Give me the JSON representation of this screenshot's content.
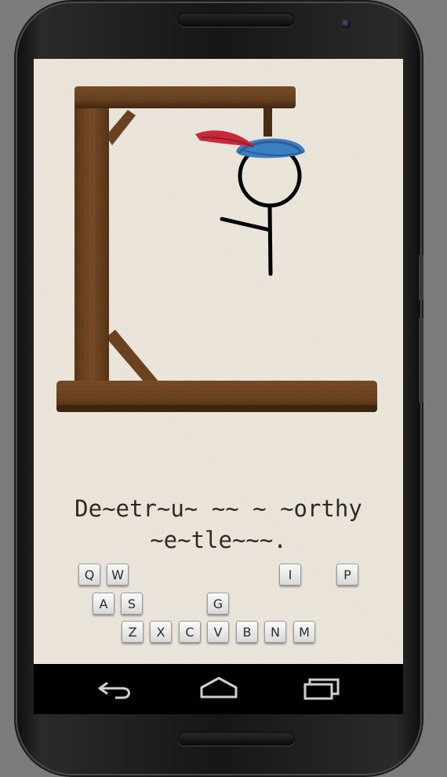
{
  "game": {
    "phrase_line1": "De~etr~u~ ~~ ~ ~orthy",
    "phrase_line2": "~e~tle~~~.",
    "keyboard_rows": [
      [
        "Q",
        "W",
        "I",
        "P"
      ],
      [
        "A",
        "S",
        "G"
      ],
      [
        "Z",
        "X",
        "C",
        "V",
        "B",
        "N",
        "M"
      ]
    ]
  },
  "scene": {
    "gallows_color": "#6b4423",
    "hat_color": "#3c7fc0",
    "feather_color": "#c8283a"
  },
  "navbar": {
    "back_icon": "back-arrow-icon",
    "home_icon": "home-icon",
    "recents_icon": "recent-apps-icon"
  }
}
